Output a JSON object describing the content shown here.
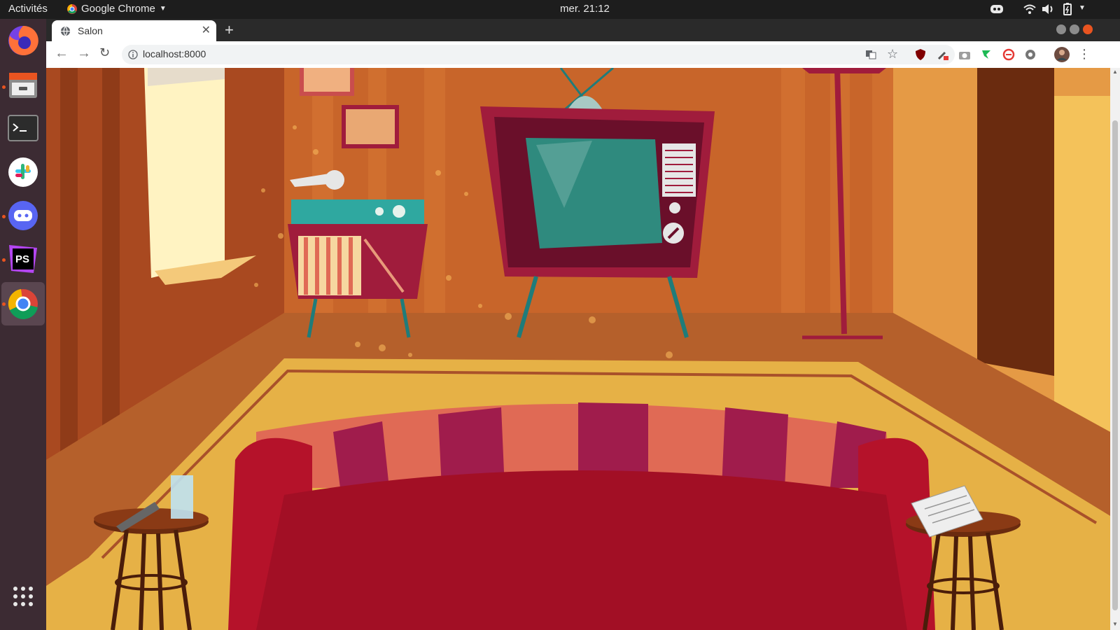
{
  "topbar": {
    "activities": "Activités",
    "app_name": "Google Chrome",
    "clock": "mer. 21:12"
  },
  "dock": {
    "apps": [
      "firefox-icon",
      "files-icon",
      "terminal-icon",
      "slack-icon",
      "discord-icon",
      "phpstorm-icon",
      "chrome-icon",
      "show-apps-icon"
    ]
  },
  "browser": {
    "tab_title": "Salon",
    "url": "localhost:8000",
    "colors": {
      "tab_bg": "#ffffff",
      "toolbar_bg": "#ffffff",
      "strip_bg": "#2a2a2a"
    }
  },
  "scene": {
    "colors": {
      "wall": "#c8652a",
      "wall_stripe": "#d97a35",
      "floor": "#b5602b",
      "rug": "#e6b146",
      "sofa": "#b5122a",
      "sofa_stripe": "#e06a55",
      "tv_body": "#a01c3c",
      "tv_screen": "#2f8a7e",
      "window_light": "#fff3c2"
    }
  }
}
